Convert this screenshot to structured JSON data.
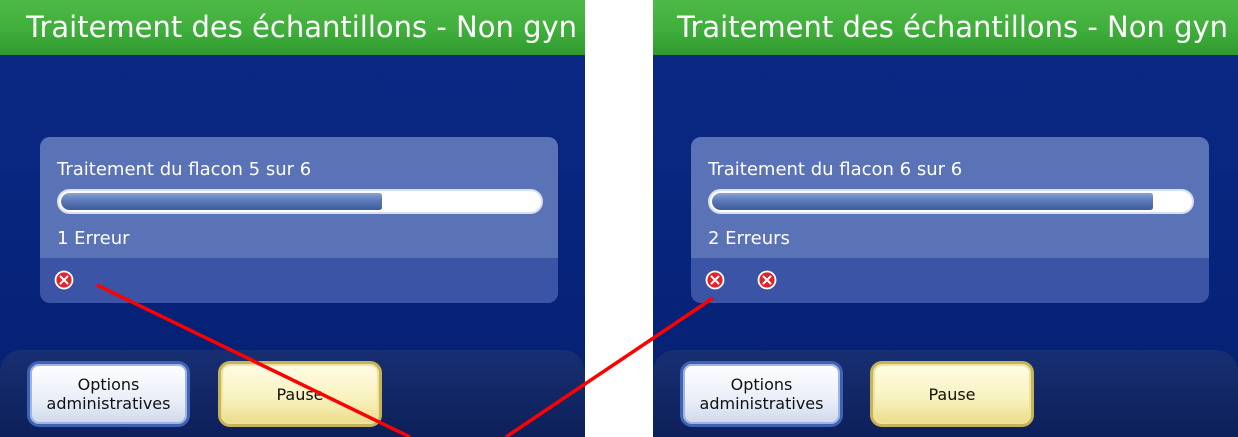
{
  "colors": {
    "title_bar": "#3fae3b",
    "screen_bg": "#0a2780",
    "annotation_line": "#ff0000",
    "error_icon": "#e0232a"
  },
  "left_screen": {
    "title": "Traitement des échantillons - Non gyn",
    "status_text": "Traitement du flacon 5 sur 6",
    "progress_fraction": 0.67,
    "error_count_text": "1 Erreur",
    "error_icons": [
      "error-x-icon"
    ],
    "buttons": {
      "admin_line1": "Options",
      "admin_line2": "administratives",
      "pause": "Pause"
    }
  },
  "right_screen": {
    "title": "Traitement des échantillons - Non gyn",
    "status_text": "Traitement du flacon 6 sur 6",
    "progress_fraction": 0.92,
    "error_count_text": "2 Erreurs",
    "error_icons": [
      "error-x-icon",
      "error-x-icon"
    ],
    "buttons": {
      "admin_line1": "Options",
      "admin_line2": "administratives",
      "pause": "Pause"
    }
  }
}
